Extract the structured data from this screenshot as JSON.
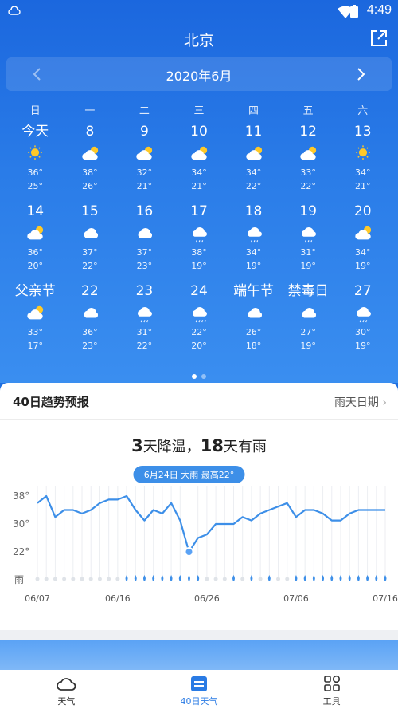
{
  "status": {
    "time": "4:49"
  },
  "header": {
    "city": "北京",
    "month": "2020年6月"
  },
  "weekdays": [
    "日",
    "一",
    "二",
    "三",
    "四",
    "五",
    "六"
  ],
  "days": [
    {
      "label": "今天",
      "icon": "sun-icon",
      "hi": "36°",
      "lo": "25°"
    },
    {
      "label": "8",
      "icon": "partly-cloudy-icon",
      "hi": "38°",
      "lo": "26°"
    },
    {
      "label": "9",
      "icon": "partly-cloudy-icon",
      "hi": "32°",
      "lo": "21°"
    },
    {
      "label": "10",
      "icon": "partly-cloudy-icon",
      "hi": "34°",
      "lo": "21°"
    },
    {
      "label": "11",
      "icon": "partly-cloudy-icon",
      "hi": "34°",
      "lo": "22°"
    },
    {
      "label": "12",
      "icon": "partly-cloudy-icon",
      "hi": "33°",
      "lo": "22°"
    },
    {
      "label": "13",
      "icon": "sun-icon",
      "hi": "34°",
      "lo": "21°"
    },
    {
      "label": "14",
      "icon": "partly-cloudy-icon",
      "hi": "36°",
      "lo": "20°"
    },
    {
      "label": "15",
      "icon": "cloudy-icon",
      "hi": "37°",
      "lo": "22°"
    },
    {
      "label": "16",
      "icon": "cloudy-icon",
      "hi": "37°",
      "lo": "23°"
    },
    {
      "label": "17",
      "icon": "rain-icon",
      "hi": "38°",
      "lo": "19°"
    },
    {
      "label": "18",
      "icon": "rain-icon",
      "hi": "34°",
      "lo": "19°"
    },
    {
      "label": "19",
      "icon": "rain-icon",
      "hi": "31°",
      "lo": "19°"
    },
    {
      "label": "20",
      "icon": "partly-cloudy-icon",
      "hi": "34°",
      "lo": "19°"
    },
    {
      "label": "父亲节",
      "icon": "partly-cloudy-icon",
      "hi": "33°",
      "lo": "17°"
    },
    {
      "label": "22",
      "icon": "cloudy-icon",
      "hi": "36°",
      "lo": "23°"
    },
    {
      "label": "23",
      "icon": "rain-icon",
      "hi": "31°",
      "lo": "22°"
    },
    {
      "label": "24",
      "icon": "heavy-rain-icon",
      "hi": "22°",
      "lo": "20°"
    },
    {
      "label": "端午节",
      "icon": "cloudy-icon",
      "hi": "26°",
      "lo": "18°"
    },
    {
      "label": "禁毒日",
      "icon": "cloudy-icon",
      "hi": "27°",
      "lo": "19°"
    },
    {
      "label": "27",
      "icon": "rain-icon",
      "hi": "30°",
      "lo": "19°"
    }
  ],
  "trend": {
    "title": "40日趋势预报",
    "link": "雨天日期",
    "cool_days": "3",
    "cool_text": "天降温，",
    "rain_days": "18",
    "rain_text": "天有雨",
    "tooltip": "6月24日 大雨 最高22°",
    "rain_label": "雨"
  },
  "chart_data": {
    "type": "line",
    "y_ticks": [
      "38°",
      "30°",
      "22°"
    ],
    "ylim": [
      22,
      38
    ],
    "x_ticks": [
      "06/07",
      "06/16",
      "06/26",
      "07/06",
      "07/16"
    ],
    "x_tick_index": [
      0,
      9,
      19,
      29,
      39
    ],
    "highlight_index": 17,
    "series": [
      {
        "values": [
          36,
          38,
          32,
          34,
          34,
          33,
          34,
          36,
          37,
          37,
          38,
          34,
          31,
          34,
          33,
          36,
          31,
          22,
          26,
          27,
          30,
          30,
          30,
          32,
          31,
          33,
          34,
          35,
          36,
          32,
          34,
          34,
          33,
          31,
          31,
          33,
          34,
          34,
          34,
          34
        ]
      }
    ],
    "rain": [
      0,
      0,
      0,
      0,
      0,
      0,
      0,
      0,
      0,
      0,
      1,
      1,
      1,
      1,
      1,
      1,
      1,
      1,
      1,
      0,
      0,
      0,
      1,
      0,
      1,
      0,
      1,
      0,
      0,
      1,
      1,
      1,
      1,
      1,
      1,
      1,
      1,
      1,
      1,
      1
    ]
  },
  "nav": [
    {
      "label": "天气",
      "icon": "cloud-icon"
    },
    {
      "label": "40日天气",
      "icon": "calendar-icon"
    },
    {
      "label": "工具",
      "icon": "tools-icon"
    }
  ],
  "colors": {
    "accent": "#2a7be4",
    "line": "#3d8fe8"
  }
}
